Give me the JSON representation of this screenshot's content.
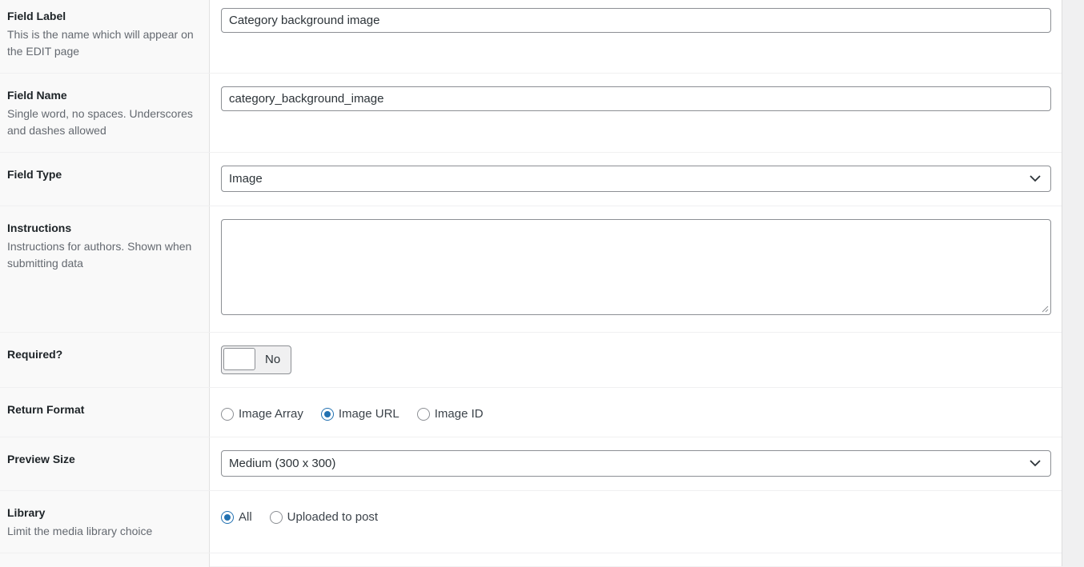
{
  "fields": {
    "field_label": {
      "title": "Field Label",
      "desc": "This is the name which will appear on the EDIT page",
      "value": "Category background image"
    },
    "field_name": {
      "title": "Field Name",
      "desc": "Single word, no spaces. Underscores and dashes allowed",
      "value": "category_background_image"
    },
    "field_type": {
      "title": "Field Type",
      "value": "Image"
    },
    "instructions": {
      "title": "Instructions",
      "desc": "Instructions for authors. Shown when submitting data",
      "value": ""
    },
    "required": {
      "title": "Required?",
      "toggle_label": "No"
    },
    "return_format": {
      "title": "Return Format",
      "options": [
        "Image Array",
        "Image URL",
        "Image ID"
      ],
      "selected": "Image URL"
    },
    "preview_size": {
      "title": "Preview Size",
      "value": "Medium (300 x 300)"
    },
    "library": {
      "title": "Library",
      "desc": "Limit the media library choice",
      "options": [
        "All",
        "Uploaded to post"
      ],
      "selected": "All"
    }
  },
  "icons": {
    "select_arrow": "chevron-down-icon",
    "textarea_grip": "resize-handle-icon"
  },
  "colors": {
    "accent": "#2271b1",
    "label_bg": "#f9f9f9",
    "border": "#8c8f94"
  }
}
